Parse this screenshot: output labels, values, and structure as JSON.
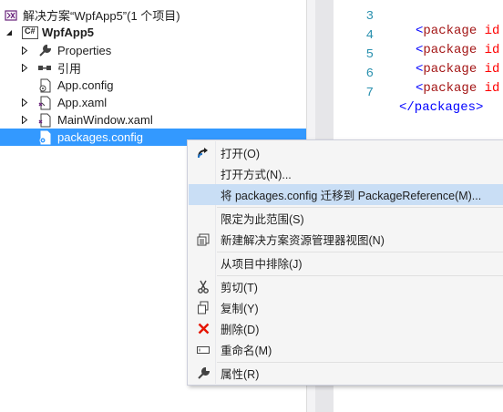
{
  "solution_explorer": {
    "solution_label": "解决方案“WpfApp5”(1 个项目)",
    "project_badge": "C#",
    "project_label": "WpfApp5",
    "items": [
      {
        "label": "Properties"
      },
      {
        "label": "引用"
      },
      {
        "label": "App.config"
      },
      {
        "label": "App.xaml"
      },
      {
        "label": "MainWindow.xaml"
      },
      {
        "label": "packages.config"
      }
    ]
  },
  "editor": {
    "lines": [
      {
        "number": "3",
        "text": "<package id"
      },
      {
        "number": "4",
        "text": "<package id"
      },
      {
        "number": "5",
        "text": "<package id"
      },
      {
        "number": "6",
        "text": "<package id"
      },
      {
        "number": "7",
        "text": "</packages>"
      }
    ]
  },
  "context_menu": {
    "items": [
      {
        "label": "打开(O)",
        "icon": "open-arrow-icon"
      },
      {
        "label": "打开方式(N)...",
        "icon": ""
      },
      {
        "label": "将 packages.config 迁移到 PackageReference(M)...",
        "icon": ""
      },
      {
        "label": "限定为此范围(S)",
        "icon": ""
      },
      {
        "label": "新建解决方案资源管理器视图(N)",
        "icon": "new-view-icon"
      },
      {
        "label": "从项目中排除(J)",
        "icon": ""
      },
      {
        "label": "剪切(T)",
        "icon": "scissors-icon"
      },
      {
        "label": "复制(Y)",
        "icon": "copy-icon"
      },
      {
        "label": "删除(D)",
        "icon": "delete-x-icon"
      },
      {
        "label": "重命名(M)",
        "icon": "rename-icon"
      },
      {
        "label": "属性(R)",
        "icon": "wrench-icon"
      }
    ]
  },
  "colors": {
    "selection": "#3399ff",
    "menu_hover": "#c9def5",
    "delete_red": "#e51400",
    "vs_purple": "#68217a"
  }
}
